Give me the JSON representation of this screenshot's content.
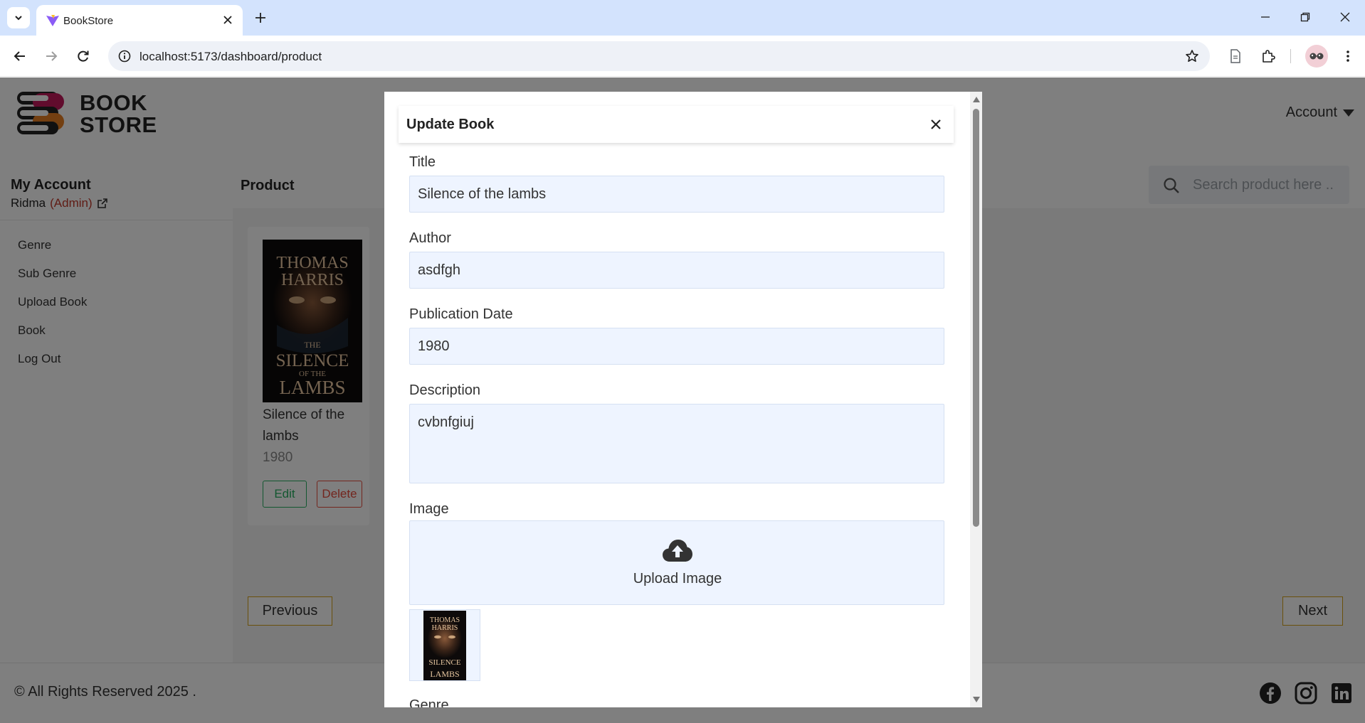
{
  "browser": {
    "tab_title": "BookStore",
    "url": "localhost:5173/dashboard/product"
  },
  "header": {
    "logo_line1": "BOOK",
    "logo_line2": "STORE",
    "account_label": "Account"
  },
  "sidebar": {
    "heading": "My Account",
    "user_name": "Ridma",
    "user_role": "(Admin)",
    "items": [
      {
        "label": "Genre"
      },
      {
        "label": "Sub Genre"
      },
      {
        "label": "Upload Book"
      },
      {
        "label": "Book"
      },
      {
        "label": "Log Out"
      }
    ]
  },
  "main": {
    "title": "Product",
    "search_placeholder": "Search product here ..",
    "card": {
      "cover_author_line1": "THOMAS",
      "cover_author_line2": "HARRIS",
      "cover_title_the": "THE",
      "cover_title_silence": "SILENCE",
      "cover_title_of_the": "OF THE",
      "cover_title_lambs": "LAMBS",
      "title": "Silence of the lambs",
      "year": "1980",
      "edit_label": "Edit",
      "delete_label": "Delete"
    },
    "prev_label": "Previous",
    "next_label": "Next"
  },
  "footer": {
    "copyright": "© All Rights Reserved 2025 ."
  },
  "modal": {
    "title": "Update Book",
    "title_label": "Title",
    "title_value": "Silence of the lambs",
    "author_label": "Author",
    "author_value": "asdfgh",
    "pubdate_label": "Publication Date",
    "pubdate_value": "1980",
    "description_label": "Description",
    "description_value": "cvbnfgiuj",
    "image_label": "Image",
    "upload_text": "Upload Image",
    "genre_label": "Genre"
  },
  "colors": {
    "overlay": "rgba(0,0,0,0.5)",
    "input_bg": "#eef4ff",
    "edit_green": "#27ae60",
    "delete_red": "#e74c3c",
    "pager_border": "#d4a017",
    "admin_red": "#c0392b"
  },
  "icons": [
    "chevron-down-icon",
    "vite-favicon",
    "close-icon",
    "plus-icon",
    "minimize-icon",
    "restore-icon",
    "back-arrow-icon",
    "forward-arrow-icon",
    "reload-icon",
    "site-info-icon",
    "star-icon",
    "reading-list-icon",
    "extensions-icon",
    "external-link-icon",
    "search-icon",
    "cloud-upload-icon",
    "facebook-icon",
    "instagram-icon",
    "linkedin-icon"
  ]
}
